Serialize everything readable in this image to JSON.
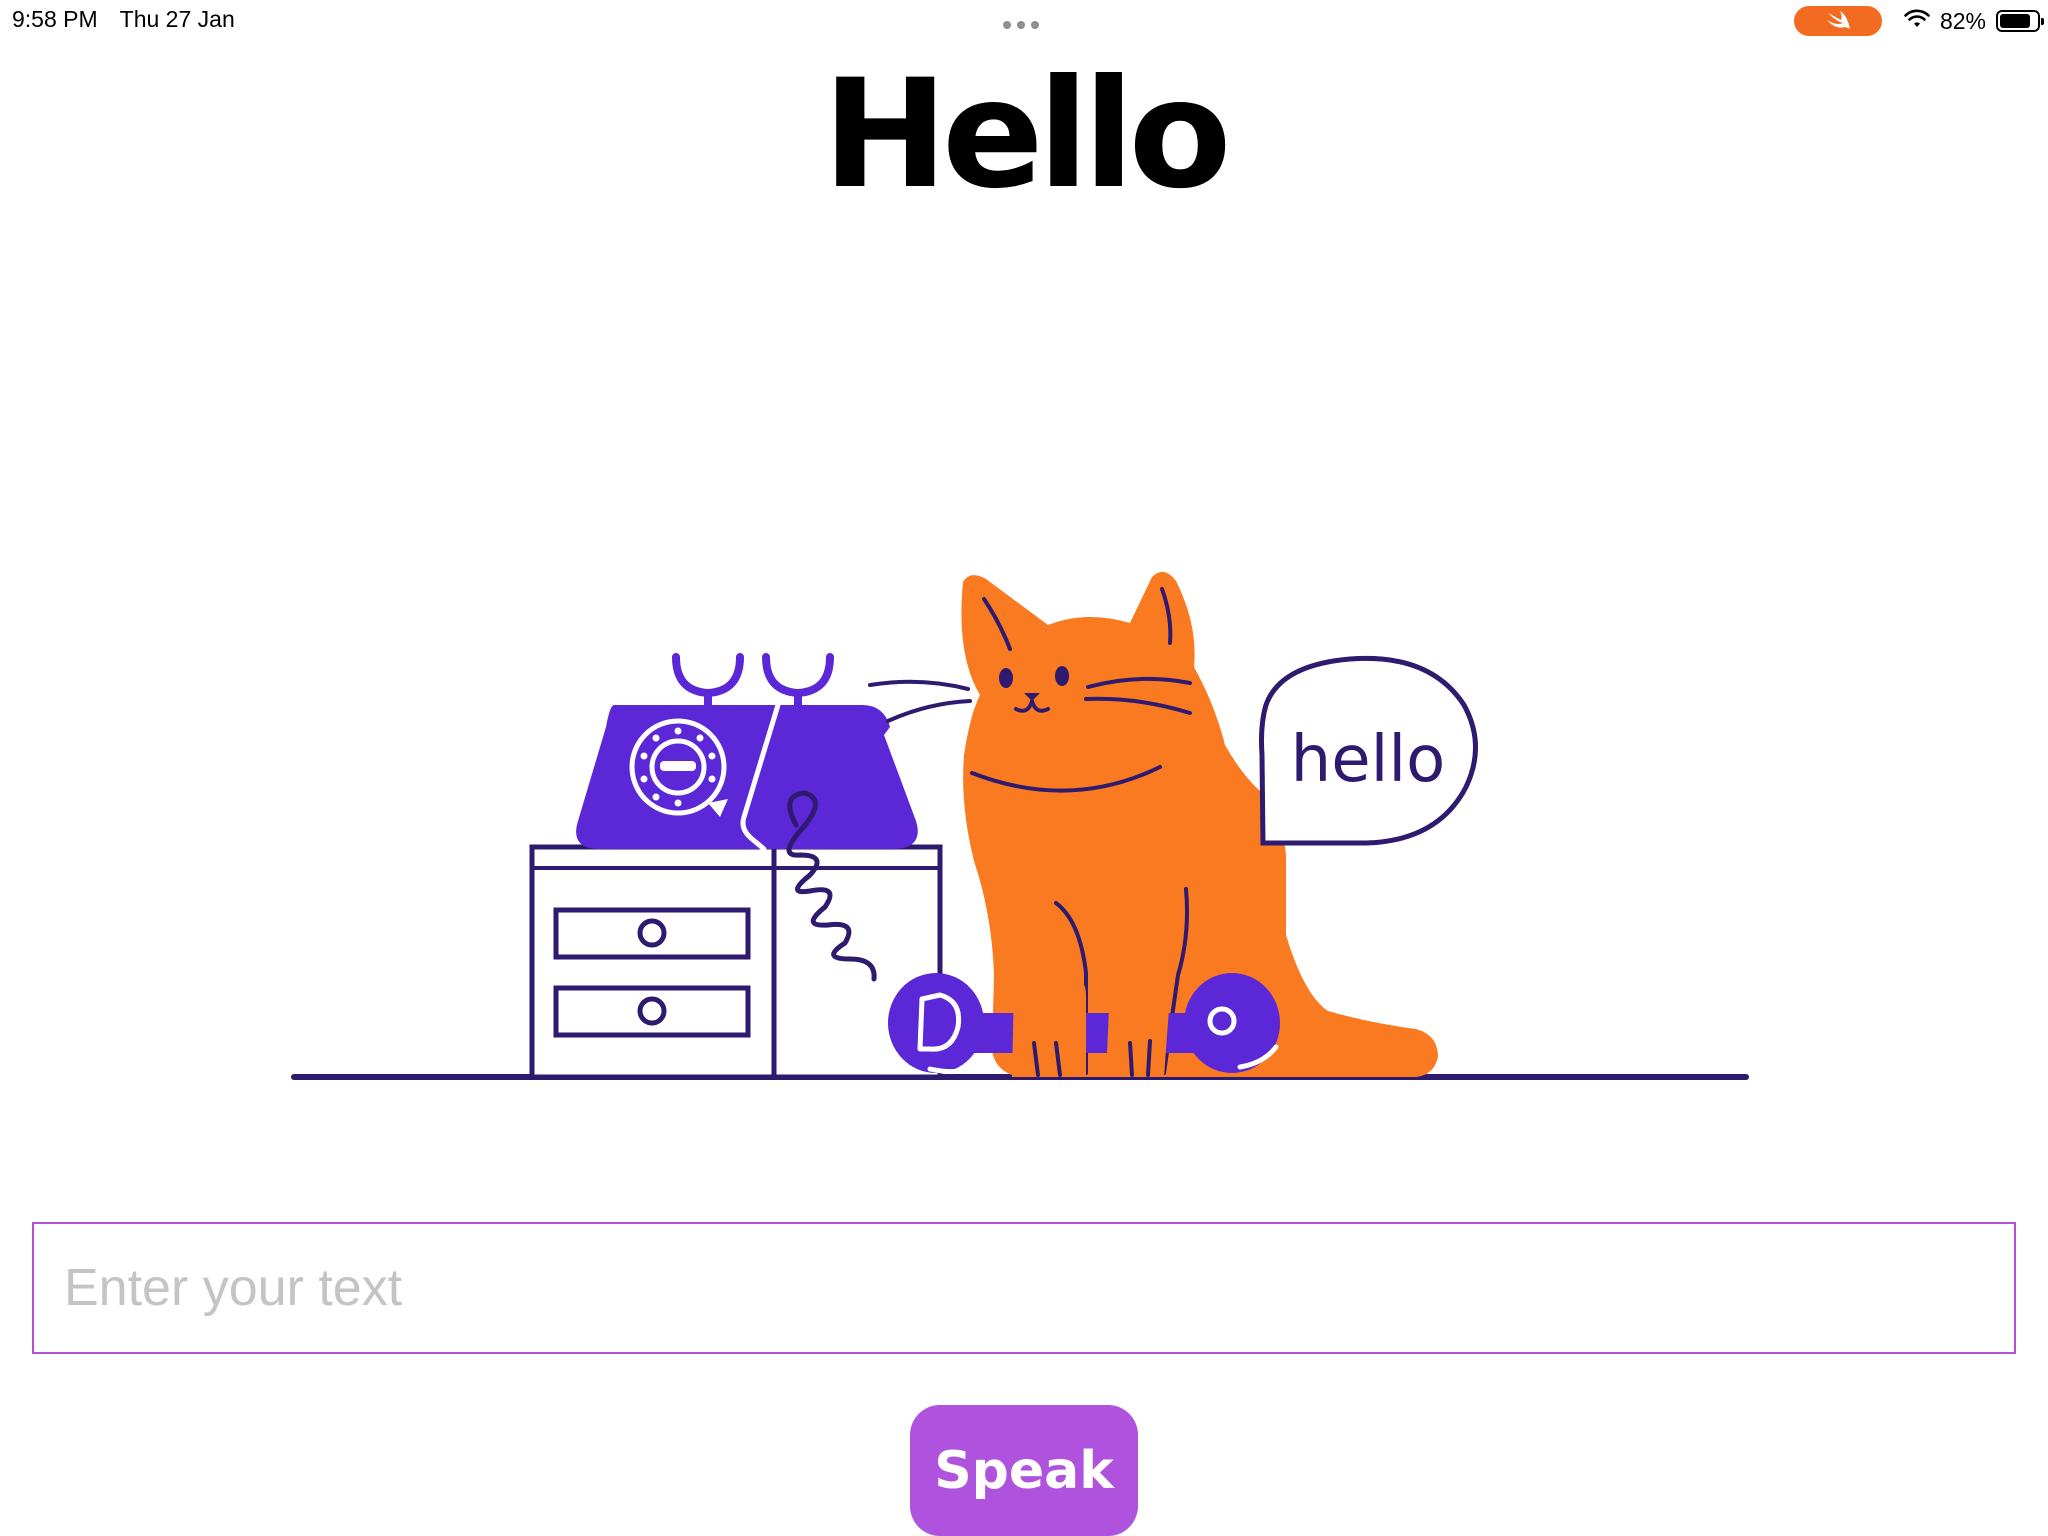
{
  "status_bar": {
    "time": "9:58 PM",
    "date": "Thu 27 Jan",
    "battery_percent": "82%",
    "battery_level": 0.82,
    "icons": [
      "swift-playgrounds-icon",
      "wifi-icon",
      "battery-icon"
    ]
  },
  "title": "Hello",
  "illustration": {
    "speech_bubble_text": "hello"
  },
  "input": {
    "placeholder": "Enter your text",
    "value": ""
  },
  "speak_button": {
    "label": "Speak"
  },
  "colors": {
    "accent": "#af52de",
    "input_border": "#b64fd8",
    "cat_orange": "#fa7a22",
    "phone_purple": "#5c27d6",
    "line_navy": "#2e1a6e",
    "status_pill": "#f26b21"
  }
}
